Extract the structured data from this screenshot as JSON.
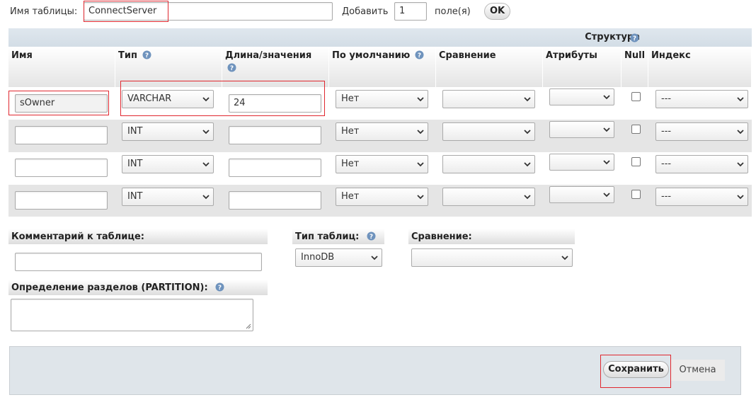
{
  "top": {
    "table_name_label": "Имя таблицы:",
    "table_name_value": "ConnectServer",
    "add_label": "Добавить",
    "add_count": "1",
    "fields_label": "поле(я)",
    "ok_label": "OK"
  },
  "structure_label": "Структура",
  "columns": {
    "name": "Имя",
    "type": "Тип",
    "length": "Длина/значения",
    "default": "По умолчанию",
    "collation": "Сравнение",
    "attributes": "Атрибуты",
    "null": "Null",
    "index": "Индекс"
  },
  "rows": [
    {
      "name": "sOwner",
      "type": "VARCHAR",
      "length": "24",
      "default": "Нет",
      "collation": "",
      "attributes": "",
      "index": "---"
    },
    {
      "name": "",
      "type": "INT",
      "length": "",
      "default": "Нет",
      "collation": "",
      "attributes": "",
      "index": "---"
    },
    {
      "name": "",
      "type": "INT",
      "length": "",
      "default": "Нет",
      "collation": "",
      "attributes": "",
      "index": "---"
    },
    {
      "name": "",
      "type": "INT",
      "length": "",
      "default": "Нет",
      "collation": "",
      "attributes": "",
      "index": "---"
    }
  ],
  "table_comment_label": "Комментарий к таблице:",
  "table_comment_value": "",
  "engine_label": "Тип таблиц:",
  "engine_value": "InnoDB",
  "table_collation_label": "Сравнение:",
  "table_collation_value": "",
  "partition_label": "Определение разделов (PARTITION):",
  "partition_value": "",
  "save_label": "Сохранить",
  "cancel_label": "Отмена",
  "colors": {
    "highlight": "#e0272f",
    "header_band": "#d3dde6",
    "help_icon": "#6f93bd"
  },
  "icons": {
    "help": "help-icon",
    "dropdown": "chevron-down-icon"
  }
}
